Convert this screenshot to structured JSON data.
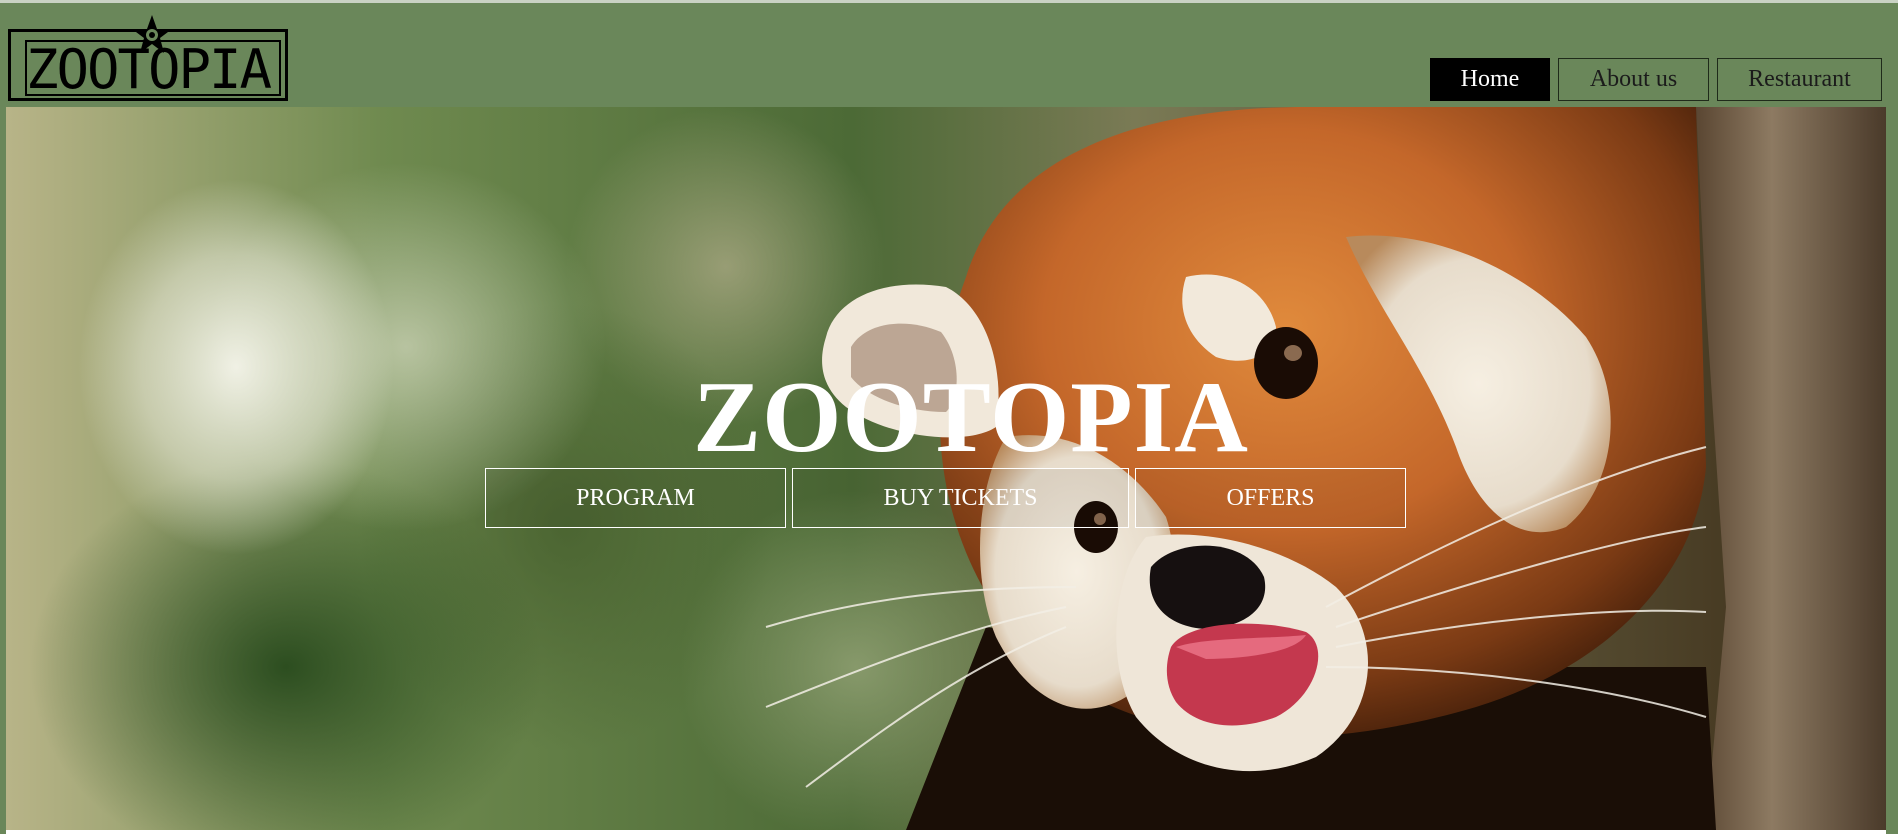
{
  "logo": {
    "text": "ZOOTOPIA",
    "icon": "star-icon"
  },
  "nav": {
    "items": [
      {
        "label": "Home",
        "active": true
      },
      {
        "label": "About us",
        "active": false
      },
      {
        "label": "Restaurant",
        "active": false
      }
    ]
  },
  "hero": {
    "title": "ZOOTOPIA",
    "image": "red-panda-photo",
    "buttons": [
      {
        "label": "PROGRAM"
      },
      {
        "label": "BUY TICKETS"
      },
      {
        "label": "OFFERS"
      }
    ]
  },
  "colors": {
    "header_bg": "#6a875a",
    "active_nav_bg": "#000000",
    "hero_text": "#ffffff"
  }
}
